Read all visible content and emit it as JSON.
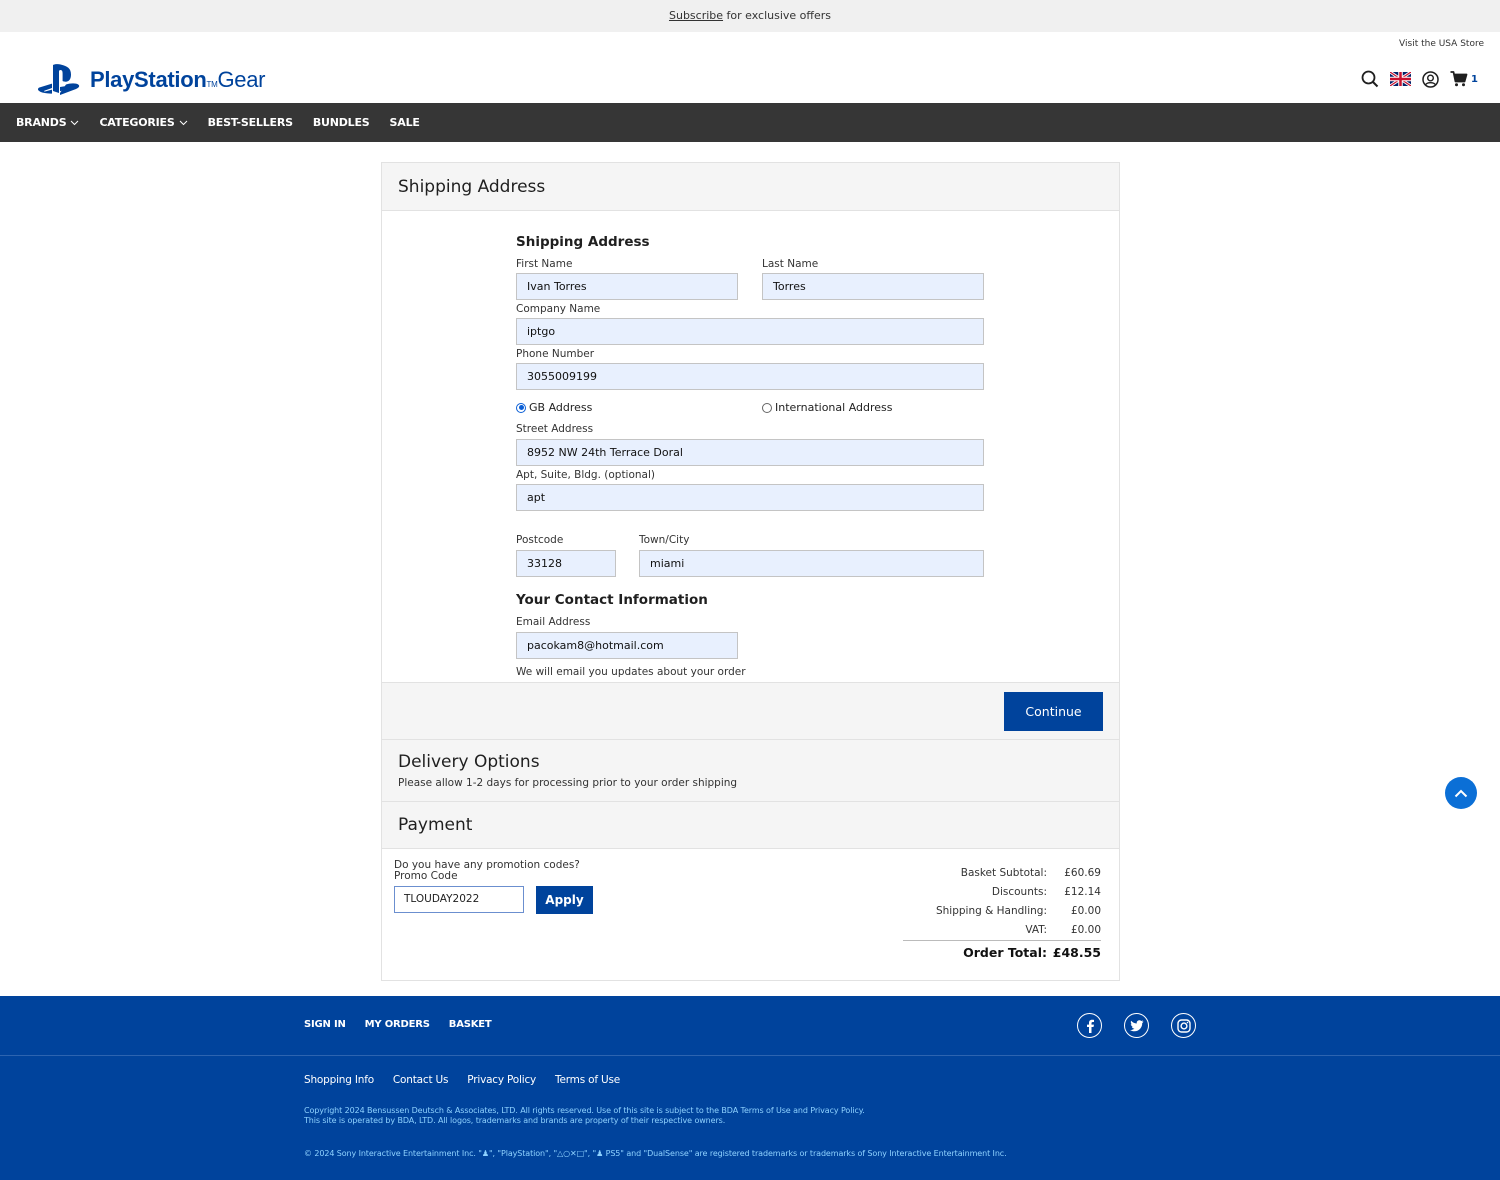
{
  "promo_bar": {
    "link": "Subscribe",
    "text": " for exclusive offers"
  },
  "header": {
    "usa_link": "Visit the USA Store",
    "logo_main": "PlayStation",
    "logo_tm": "TM",
    "logo_gear": "Gear",
    "cart_count": "1",
    "icons": [
      "search-icon",
      "uk-flag-icon",
      "account-icon",
      "cart-icon"
    ]
  },
  "nav": {
    "items": [
      {
        "label": "BRANDS",
        "dropdown": true
      },
      {
        "label": "CATEGORIES",
        "dropdown": true
      },
      {
        "label": "BEST-SELLERS",
        "dropdown": false
      },
      {
        "label": "BUNDLES",
        "dropdown": false
      },
      {
        "label": "SALE",
        "dropdown": false
      }
    ]
  },
  "shipping": {
    "section_title": "Shipping Address",
    "form_title": "Shipping Address",
    "first_name": {
      "label": "First Name",
      "value": "Ivan Torres"
    },
    "last_name": {
      "label": "Last Name",
      "value": "Torres"
    },
    "company": {
      "label": "Company Name",
      "value": "iptgo"
    },
    "phone": {
      "label": "Phone Number",
      "value": "3055009199"
    },
    "address_type": {
      "gb": "GB Address",
      "international": "International Address",
      "selected": "gb"
    },
    "street": {
      "label": "Street Address",
      "value": "8952 NW 24th Terrace Doral"
    },
    "apt": {
      "label": "Apt, Suite, Bldg. (optional)",
      "value": "apt"
    },
    "postcode": {
      "label": "Postcode",
      "value": "33128"
    },
    "town": {
      "label": "Town/City",
      "value": "miami"
    },
    "contact_title": "Your Contact Information",
    "email": {
      "label": "Email Address",
      "value": "pacokam8@hotmail.com"
    },
    "email_note": "We will email you updates about your order",
    "continue_label": "Continue"
  },
  "delivery": {
    "title": "Delivery Options",
    "note": "Please allow 1-2 days for processing prior to your order shipping"
  },
  "payment": {
    "title": "Payment",
    "promo_question": "Do you have any promotion codes?",
    "promo_label": "Promo Code",
    "promo_value": "TLOUDAY2022",
    "apply_label": "Apply",
    "totals": {
      "subtotal_label": "Basket Subtotal:",
      "subtotal": "£60.69",
      "discounts_label": "Discounts:",
      "discounts": "£12.14",
      "shipping_label": "Shipping & Handling:",
      "shipping": "£0.00",
      "vat_label": "VAT:",
      "vat": "£0.00",
      "total_label": "Order Total:",
      "total": "£48.55"
    }
  },
  "footer": {
    "links1": [
      "SIGN IN",
      "MY ORDERS",
      "BASKET"
    ],
    "social": [
      "facebook-icon",
      "twitter-icon",
      "instagram-icon"
    ],
    "links2": [
      "Shopping Info",
      "Contact Us",
      "Privacy Policy",
      "Terms of Use"
    ],
    "copyright_line1": "Copyright 2024 Bensussen Deutsch & Associates, LTD. All rights reserved. Use of this site is subject to the BDA Terms of Use and Privacy Policy.",
    "copyright_line2": "This site is operated by BDA, LTD. All logos, trademarks and brands are property of their respective owners.",
    "sie_notice": "© 2024 Sony Interactive Entertainment Inc. \"♟\", \"PlayStation\", \"△○✕□\", \"♟ PS5\" and \"DualSense\" are registered trademarks or trademarks of Sony Interactive Entertainment Inc."
  },
  "colors": {
    "brand": "#00439c",
    "nav_bg": "#363636",
    "link_light": "#8ed2ff",
    "back_to_top": "#0b6fd6"
  }
}
